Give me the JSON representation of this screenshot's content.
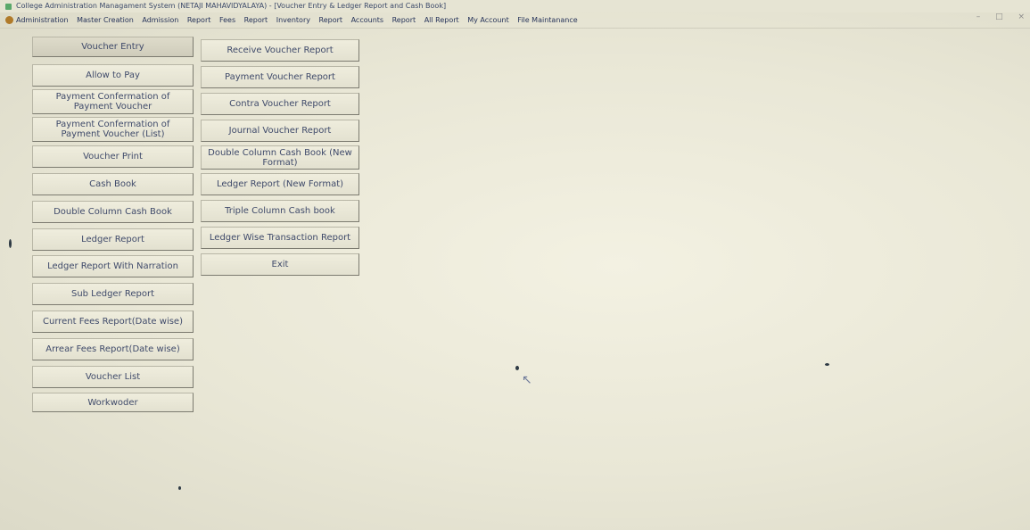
{
  "window": {
    "title": "College Administration Managament System (NETAJI MAHAVIDYALAYA) - [Voucher Entry & Ledger Report and Cash Book]",
    "controls": [
      "–",
      "□",
      "×"
    ]
  },
  "menubar": {
    "items": [
      "Administration",
      "Master Creation",
      "Admission",
      "Report",
      "Fees",
      "Report",
      "Inventory",
      "Report",
      "Accounts",
      "Report",
      "All Report",
      "My Account",
      "File Maintanance"
    ]
  },
  "left_buttons": [
    "Voucher Entry",
    "Allow to Pay",
    "Payment Confermation of Payment Voucher",
    "Payment Confermation of Payment Voucher (List)",
    "Voucher Print",
    "Cash Book",
    "Double Column Cash Book",
    "Ledger Report",
    "Ledger Report With Narration",
    "Sub Ledger Report",
    "Current Fees Report(Date wise)",
    "Arrear Fees Report(Date wise)",
    "Voucher List",
    "Workwoder"
  ],
  "right_buttons": [
    "Receive Voucher Report",
    "Payment Voucher Report",
    "Contra Voucher Report",
    "Journal Voucher Report",
    "Double Column Cash Book (New Format)",
    "Ledger Report (New Format)",
    "Triple Column Cash book",
    "Ledger Wise Transaction Report",
    "Exit"
  ]
}
